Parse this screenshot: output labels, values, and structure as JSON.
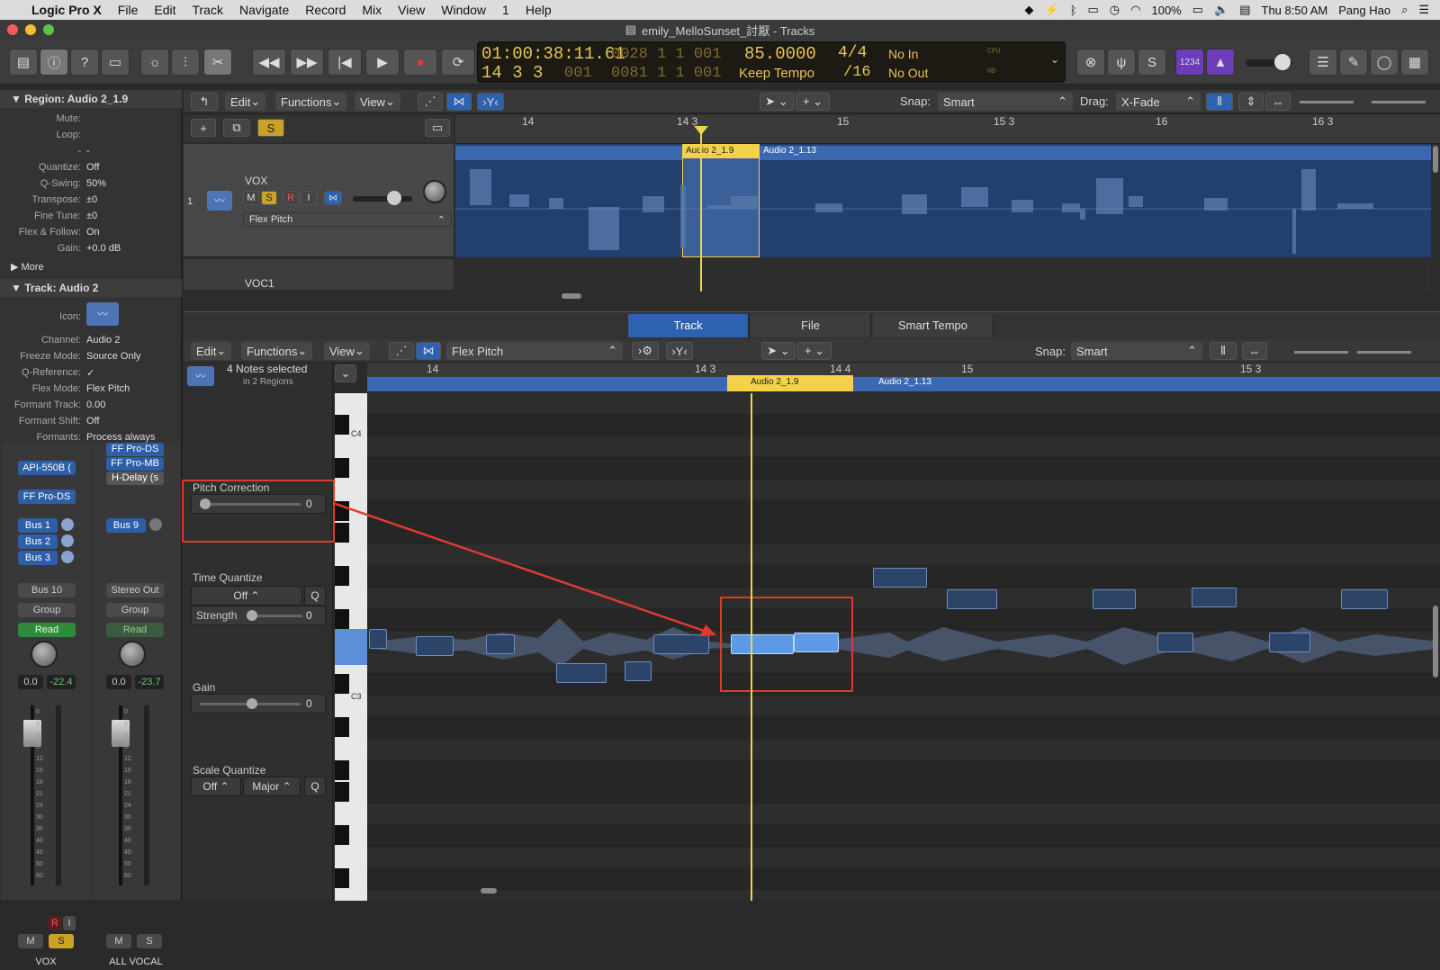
{
  "menubar": {
    "app_name": "Logic Pro X",
    "items": [
      "File",
      "Edit",
      "Track",
      "Navigate",
      "Record",
      "Mix",
      "View",
      "Window",
      "1",
      "Help"
    ],
    "battery": "100%",
    "clock": "Thu 8:50 AM",
    "user": "Pang Hao"
  },
  "window": {
    "title": "emily_MelloSunset_討厭 - Tracks"
  },
  "lcd": {
    "smpte": "01:00:38:11.61",
    "smpte_sub": "0028  1  1  001",
    "bars_beats": "14  3  3",
    "bars_beats_sub": "001",
    "end_pos": "0081  1  1  001",
    "tempo": "85.0000",
    "tempo_mode": "Keep Tempo",
    "sig_top": "4/4",
    "sig_bottom": "/16",
    "in_label": "No In",
    "out_label": "No Out",
    "cpu": "CPU",
    "hd": "HD",
    "count_in": "1234"
  },
  "inspector": {
    "region_header": "Region: Audio 2_1.9",
    "region_props": [
      {
        "k": "Mute:",
        "v": ""
      },
      {
        "k": "Loop:",
        "v": ""
      },
      {
        "k": "-",
        "v": "-"
      },
      {
        "k": "Quantize:",
        "v": "Off"
      },
      {
        "k": "Q-Swing:",
        "v": "50%"
      },
      {
        "k": "Transpose:",
        "v": "±0"
      },
      {
        "k": "Fine Tune:",
        "v": "±0"
      },
      {
        "k": "Flex & Follow:",
        "v": "On"
      },
      {
        "k": "Gain:",
        "v": "+0.0 dB"
      }
    ],
    "more": "More",
    "track_header": "Track:  Audio 2",
    "icon_label": "Icon:",
    "track_props": [
      {
        "k": "Channel:",
        "v": "Audio 2"
      },
      {
        "k": "Freeze Mode:",
        "v": "Source Only"
      },
      {
        "k": "Q-Reference:",
        "v": "✓"
      },
      {
        "k": "Flex Mode:",
        "v": "Flex Pitch"
      },
      {
        "k": "Formant Track:",
        "v": "0.00"
      },
      {
        "k": "Formant Shift:",
        "v": "Off"
      },
      {
        "k": "Formants:",
        "v": "Process always"
      }
    ],
    "strip1": {
      "plugins": [
        "API-550B (",
        "FF Pro-DS"
      ],
      "sends": [
        "Bus 1",
        "Bus 2",
        "Bus 3"
      ],
      "output": "Bus 10",
      "group": "Group",
      "automation": "Read",
      "vol": "0.0",
      "peak": "-22.4",
      "name": "VOX",
      "m": "M",
      "s": "S",
      "r": "R",
      "i": "I"
    },
    "strip2": {
      "plugins": [
        "FF Pro-DS",
        "FF Pro-MB",
        "H-Delay (s"
      ],
      "sends": [
        "Bus 9"
      ],
      "output": "Stereo Out",
      "group": "Group",
      "automation": "Read",
      "vol": "0.0",
      "peak": "-23.7",
      "name": "ALL VOCAL",
      "m": "M",
      "s": "S"
    },
    "fader_scale": [
      "0",
      "3",
      "6",
      "9",
      "12",
      "15",
      "18",
      "21",
      "24",
      "30",
      "35",
      "40",
      "45",
      "50",
      "60"
    ]
  },
  "tracks_area": {
    "menus": [
      "Edit",
      "Functions",
      "View"
    ],
    "snap_label": "Snap:",
    "snap_value": "Smart",
    "drag_label": "Drag:",
    "drag_value": "X-Fade",
    "ruler": [
      "14",
      "14 3",
      "15",
      "15 3",
      "16",
      "16 3"
    ],
    "track1": {
      "number": "1",
      "name": "VOX",
      "flex": "Flex Pitch",
      "m": "M",
      "s": "S",
      "r": "R",
      "i": "I"
    },
    "track2": {
      "name": "VOC1"
    },
    "regions": [
      "Audio 2_1.9",
      "Audio 2_1.13"
    ],
    "global_s": "S"
  },
  "editor": {
    "tabs": [
      "Track",
      "File",
      "Smart Tempo"
    ],
    "menus": [
      "Edit",
      "Functions",
      "View"
    ],
    "flex_mode": "Flex Pitch",
    "snap_label": "Snap:",
    "snap_value": "Smart",
    "notes_selected": "4 Notes selected",
    "in_regions": "in 2 Regions",
    "ruler": [
      "14",
      "14 3",
      "14 4",
      "15",
      "15 3"
    ],
    "regions": [
      "Audio 2_1.9",
      "Audio 2_1.13"
    ],
    "key_labels": {
      "c4": "C4",
      "c3": "C3"
    },
    "pitch_correction": {
      "label": "Pitch Correction",
      "value": "0",
      "level": 0
    },
    "time_quantize": {
      "label": "Time Quantize",
      "value": "Off",
      "q": "Q"
    },
    "strength": {
      "label": "Strength",
      "value": "0",
      "level": 0
    },
    "gain": {
      "label": "Gain",
      "value": "0"
    },
    "scale_quantize": {
      "label": "Scale Quantize",
      "key": "Off",
      "scale": "Major",
      "q": "Q"
    }
  },
  "colors": {
    "accent": "#2d62b0",
    "playhead": "#f2d24b",
    "region": "#3b68b0",
    "annotation": "#e03a2f",
    "note_selected": "#5d9ae6"
  }
}
